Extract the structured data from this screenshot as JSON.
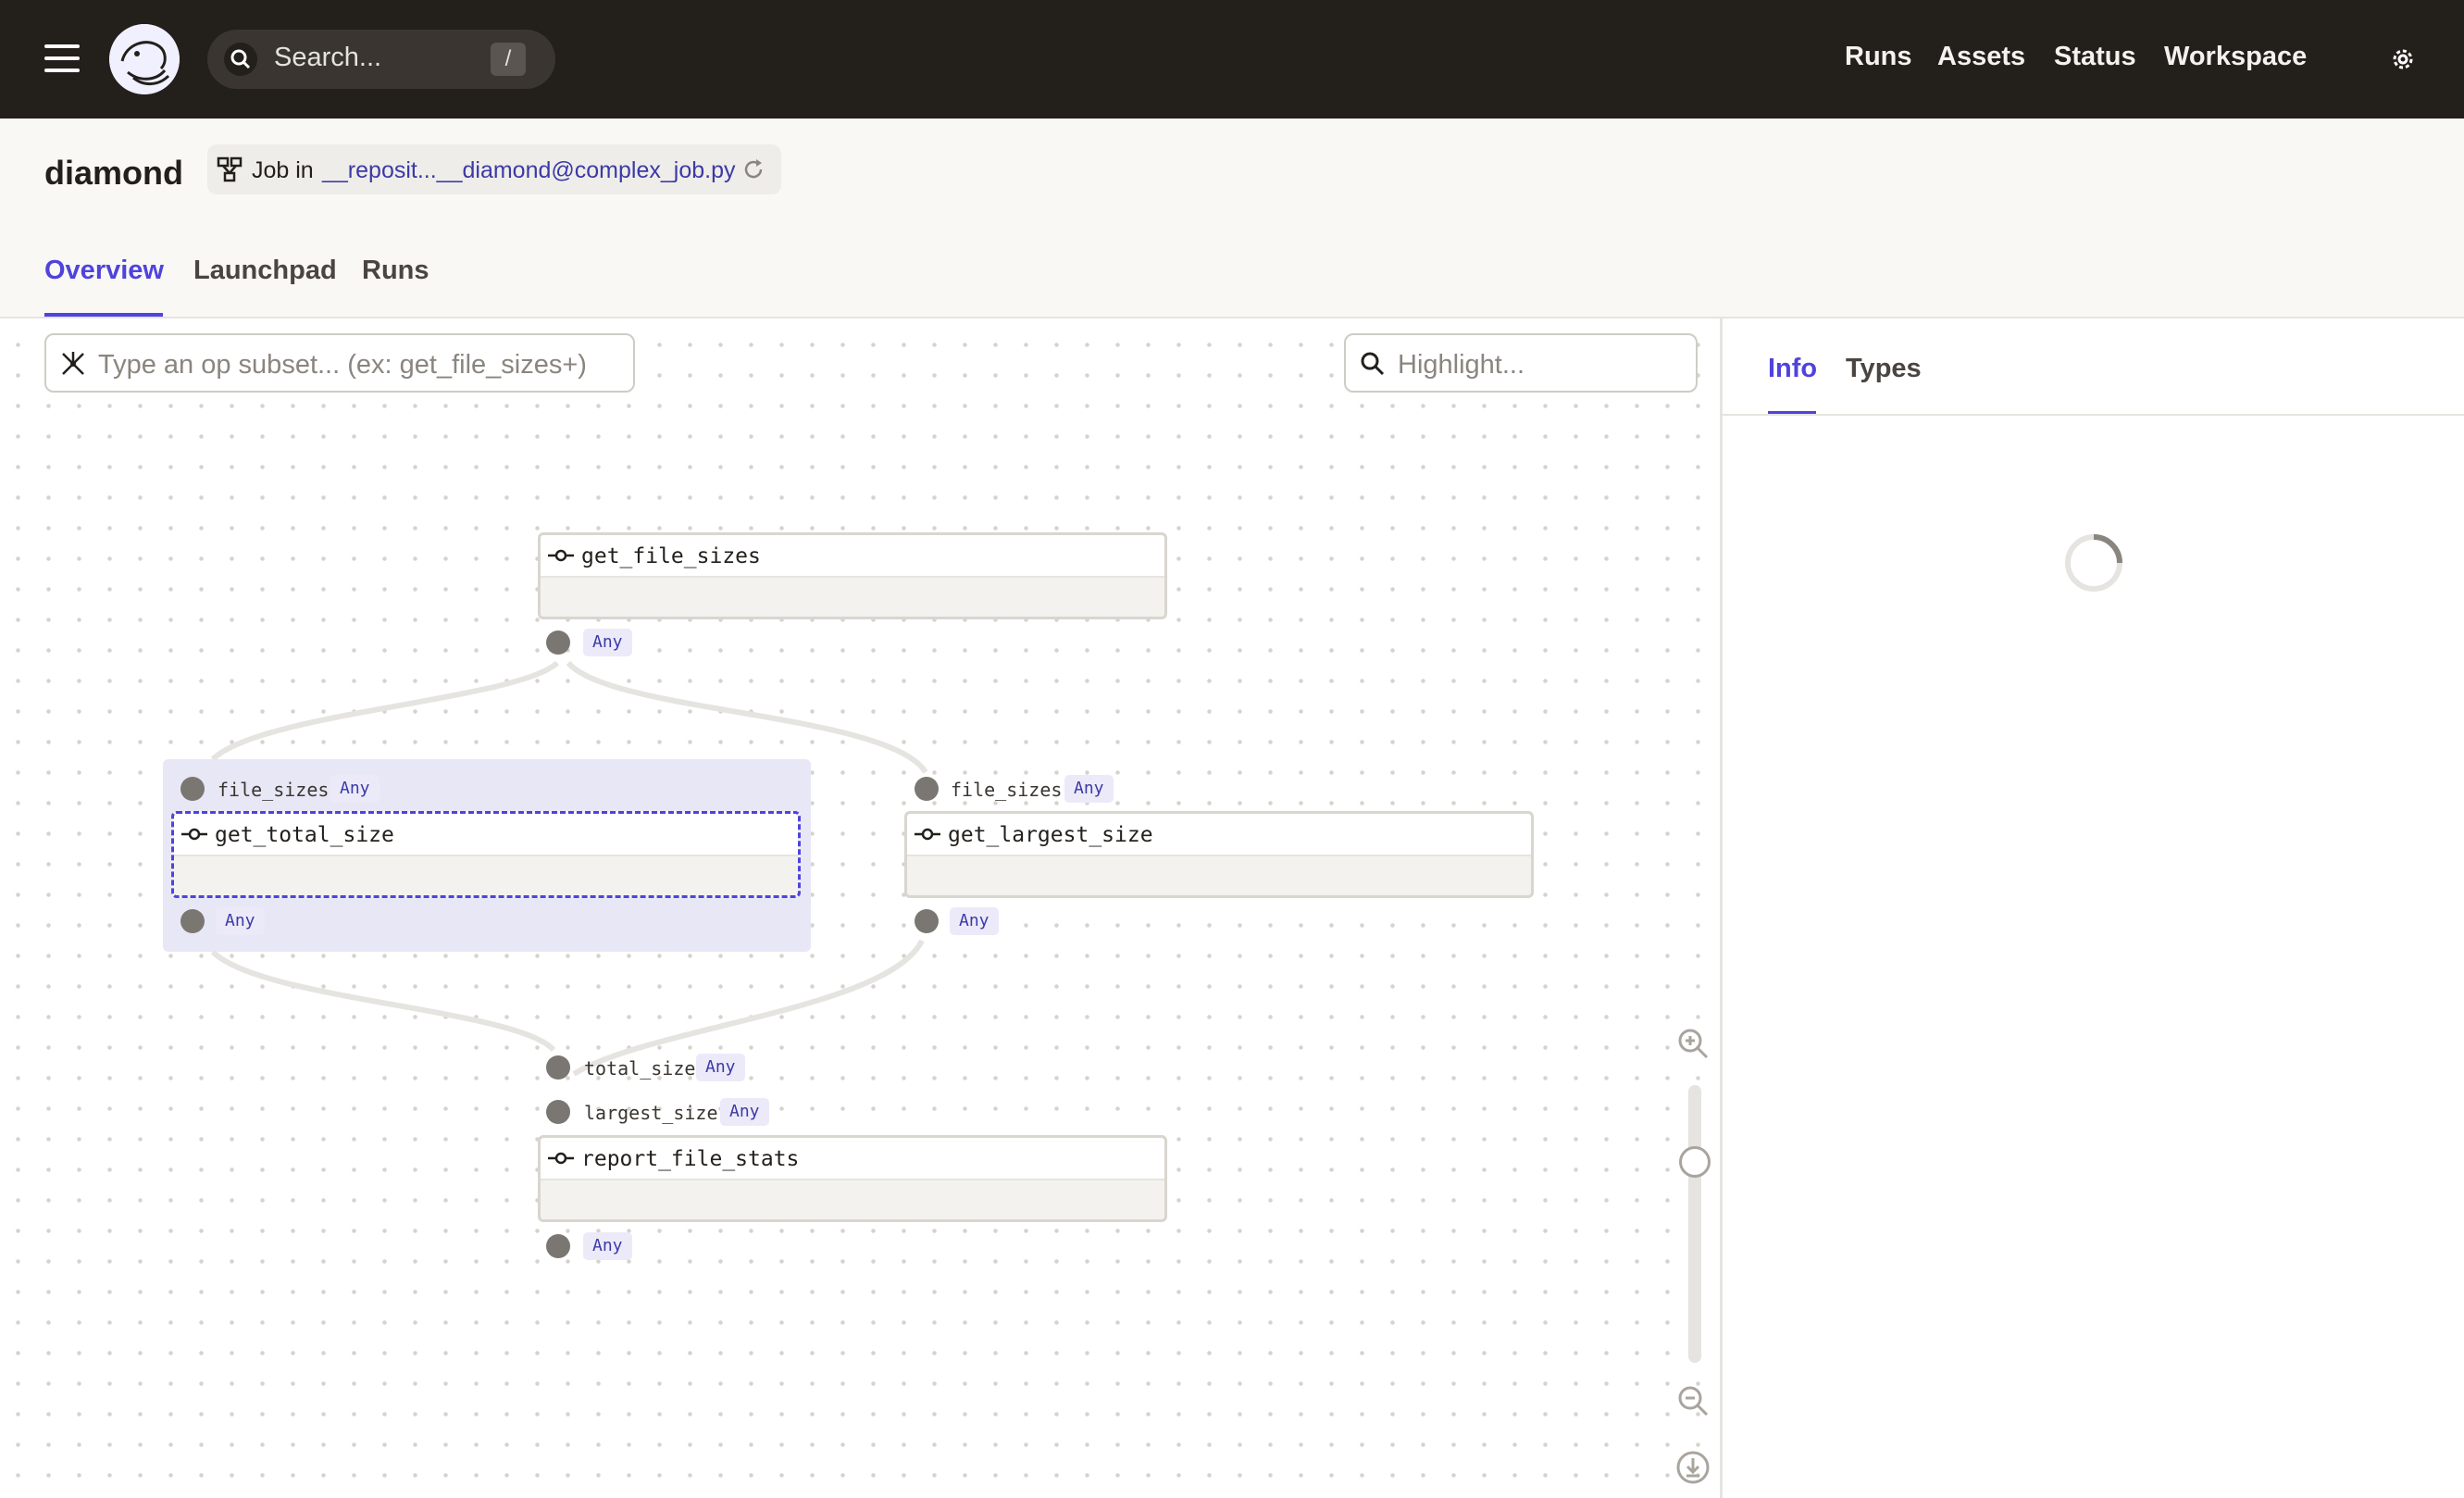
{
  "topbar": {
    "search_placeholder": "Search...",
    "search_shortcut": "/",
    "nav": [
      "Runs",
      "Assets",
      "Status",
      "Workspace"
    ]
  },
  "header": {
    "title": "diamond",
    "job_prefix": "Job in",
    "job_link": "__reposit...__diamond@complex_job.py",
    "tabs": [
      "Overview",
      "Launchpad",
      "Runs"
    ],
    "active_tab": "Overview"
  },
  "graph": {
    "op_subset_placeholder": "Type an op subset... (ex: get_file_sizes+)",
    "highlight_placeholder": "Highlight...",
    "ops": {
      "get_file_sizes": {
        "name": "get_file_sizes",
        "output_type": "Any"
      },
      "get_total_size": {
        "name": "get_total_size",
        "input_name": "file_sizes",
        "input_type": "Any",
        "output_type": "Any",
        "selected": true
      },
      "get_largest_size": {
        "name": "get_largest_size",
        "input_name": "file_sizes",
        "input_type": "Any",
        "output_type": "Any"
      },
      "report_file_stats": {
        "name": "report_file_stats",
        "input1_name": "total_size",
        "input1_type": "Any",
        "input2_name": "largest_size",
        "input2_type": "Any",
        "output_type": "Any"
      }
    }
  },
  "sidepanel": {
    "tabs": [
      "Info",
      "Types"
    ],
    "active_tab": "Info",
    "loading": true
  },
  "colors": {
    "accent": "#4f43dd",
    "topbar": "#231f1b",
    "type_chip_text": "#3b3aa6"
  }
}
